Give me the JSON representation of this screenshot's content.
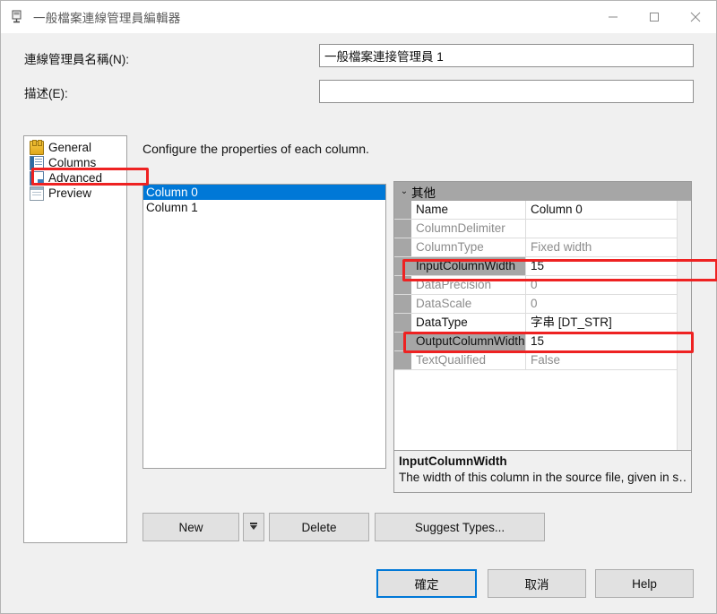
{
  "window": {
    "title": "一般檔案連線管理員編輯器",
    "icon": "connection-manager-icon",
    "minimize_label": "—",
    "maximize_label": "□",
    "close_label": "✕"
  },
  "fields": {
    "name_label": "連線管理員名稱(N):",
    "name_value": "一般檔案連接管理員 1",
    "desc_label": "描述(E):",
    "desc_value": ""
  },
  "tree": {
    "items": [
      {
        "label": "General",
        "icon": "general-icon",
        "selected": false
      },
      {
        "label": "Columns",
        "icon": "columns-icon",
        "selected": false
      },
      {
        "label": "Advanced",
        "icon": "advanced-icon",
        "selected": false
      },
      {
        "label": "Preview",
        "icon": "preview-icon",
        "selected": false
      }
    ]
  },
  "main": {
    "heading": "Configure the properties of each column.",
    "columns": [
      {
        "label": "Column 0",
        "selected": true
      },
      {
        "label": "Column 1",
        "selected": false
      }
    ]
  },
  "propgrid": {
    "group_label": "其他",
    "chevron": "⌄",
    "rows": [
      {
        "key": "Name",
        "value": "Column 0",
        "dim": false,
        "selected": false
      },
      {
        "key": "ColumnDelimiter",
        "value": "",
        "dim": true,
        "selected": false
      },
      {
        "key": "ColumnType",
        "value": "Fixed width",
        "dim": true,
        "selected": false
      },
      {
        "key": "InputColumnWidth",
        "value": "15",
        "dim": false,
        "selected": true
      },
      {
        "key": "DataPrecision",
        "value": "0",
        "dim": true,
        "selected": false
      },
      {
        "key": "DataScale",
        "value": "0",
        "dim": true,
        "selected": false
      },
      {
        "key": "DataType",
        "value": "字串 [DT_STR]",
        "dim": false,
        "selected": false
      },
      {
        "key": "OutputColumnWidth",
        "value": "15",
        "dim": false,
        "selected": true
      },
      {
        "key": "TextQualified",
        "value": "False",
        "dim": true,
        "selected": false
      }
    ]
  },
  "description": {
    "title": "InputColumnWidth",
    "text": "The width of this column in the source file, given in s…"
  },
  "buttons": {
    "new": "New",
    "new_dropdown": "dropdown-arrow-icon",
    "delete": "Delete",
    "suggest_types": "Suggest Types...",
    "ok": "確定",
    "cancel": "取消",
    "help": "Help"
  },
  "annotations": {
    "accent_color": "#ee2222",
    "highlights": [
      "Advanced",
      "InputColumnWidth",
      "OutputColumnWidth"
    ]
  }
}
